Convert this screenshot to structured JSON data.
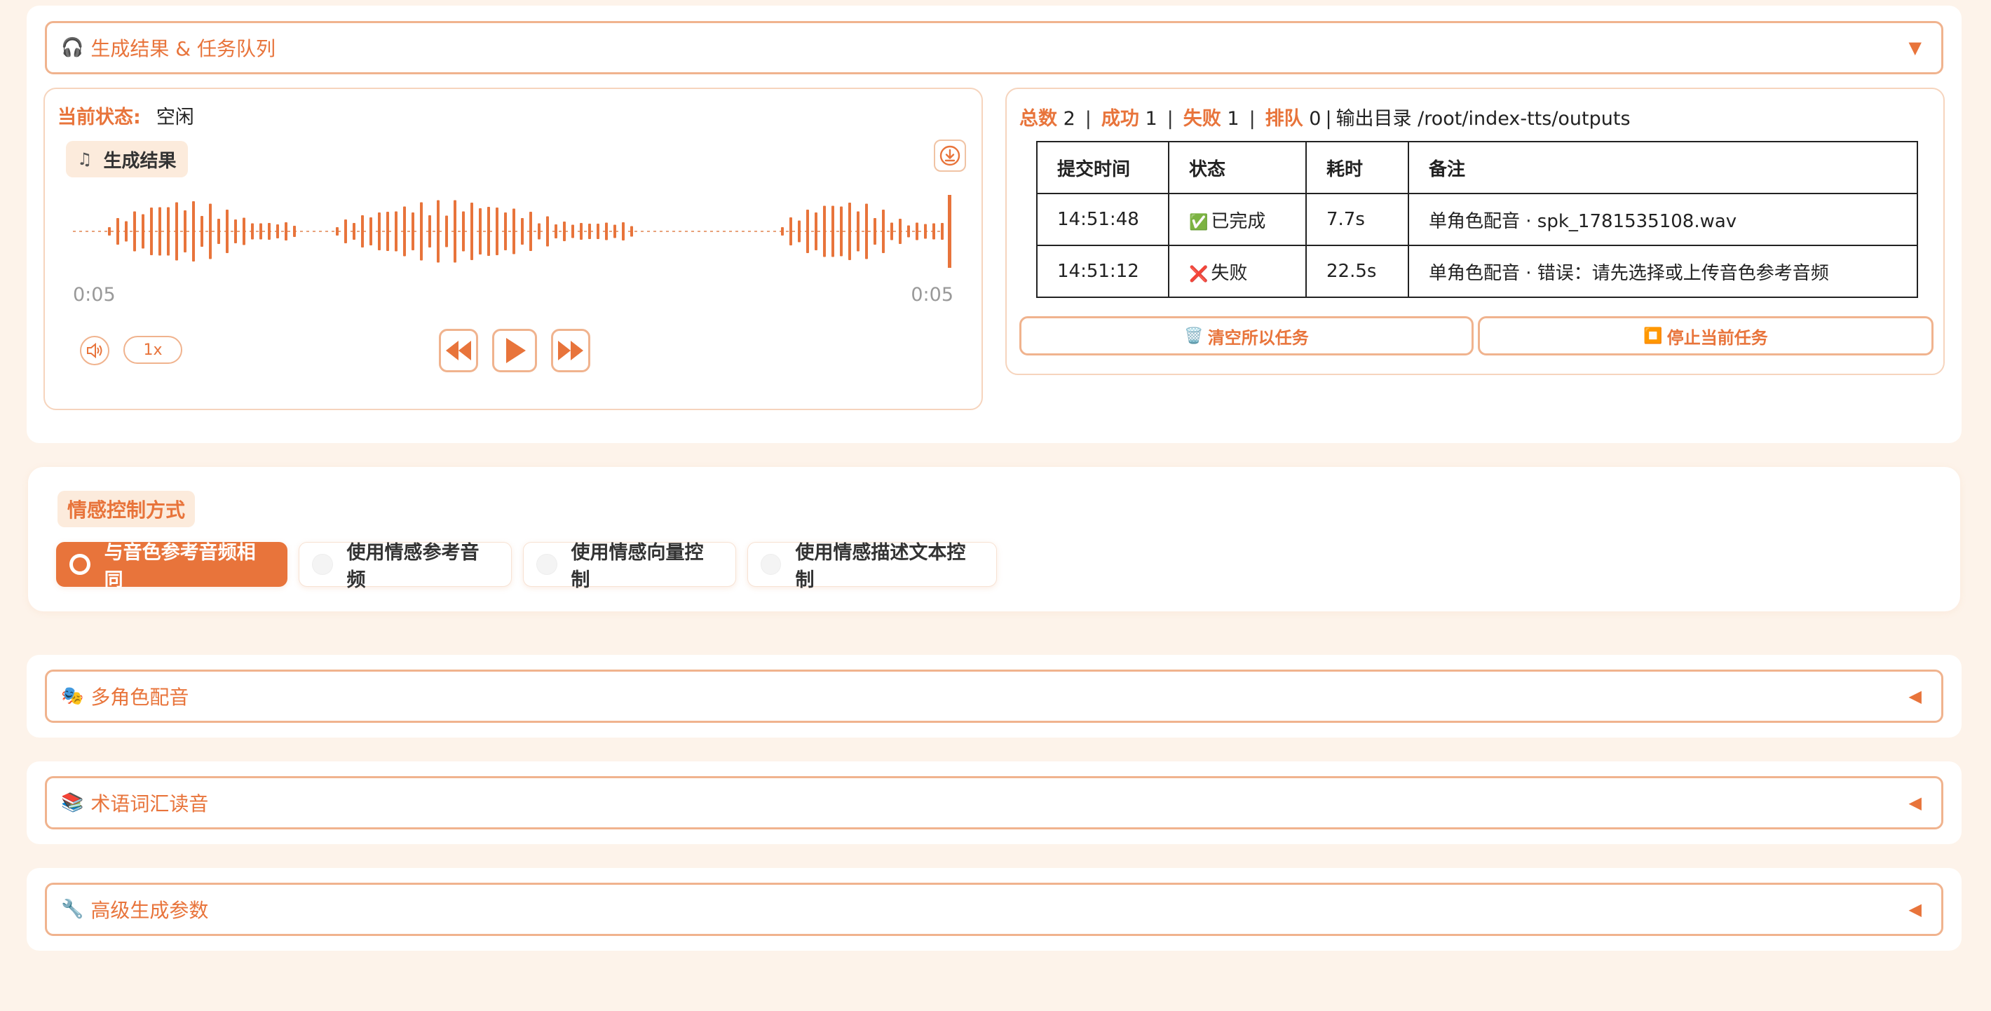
{
  "results_section": {
    "header_label": "生成结果 & 任务队列",
    "icon": "headphones-icon",
    "arrow": "▼"
  },
  "player": {
    "status_label": "当前状态:",
    "status_value": "空闲",
    "result_label": "生成结果",
    "time_current": "0:05",
    "time_total": "0:05",
    "speed": "1x"
  },
  "queue": {
    "total_label": "总数",
    "total": "2",
    "success_label": "成功",
    "success": "1",
    "fail_label": "失败",
    "fail": "1",
    "pending_label": "排队",
    "pending": "0",
    "output_dir": "输出目录 /root/index-tts/outputs",
    "columns": [
      "提交时间",
      "状态",
      "耗时",
      "备注"
    ],
    "rows": [
      {
        "time": "14:51:48",
        "status_icon": "✅",
        "status": "已完成",
        "duration": "7.7s",
        "note": "单角色配音 · spk_1781535108.wav"
      },
      {
        "time": "14:51:12",
        "status_icon": "❌",
        "status": "失败",
        "duration": "22.5s",
        "note": "单角色配音 · 错误：请先选择或上传音色参考音频"
      }
    ],
    "clear_label": "清空所以任务",
    "clear_icon": "🗑️",
    "stop_label": "停止当前任务",
    "stop_icon": "⏹️"
  },
  "emotion": {
    "title": "情感控制方式",
    "options": [
      "与音色参考音频相同",
      "使用情感参考音频",
      "使用情感向量控制",
      "使用情感描述文本控制"
    ],
    "selected": "与音色参考音频相同"
  },
  "sections": [
    {
      "icon": "🎭",
      "label": "多角色配音",
      "arrow": "◀"
    },
    {
      "icon": "📚",
      "label": "术语词汇读音",
      "arrow": "◀"
    },
    {
      "icon": "🔧",
      "label": "高级生成参数",
      "arrow": "◀"
    }
  ],
  "colors": {
    "accent": "#e8743b",
    "border": "#f0b38e",
    "background": "#fdf3ea"
  }
}
